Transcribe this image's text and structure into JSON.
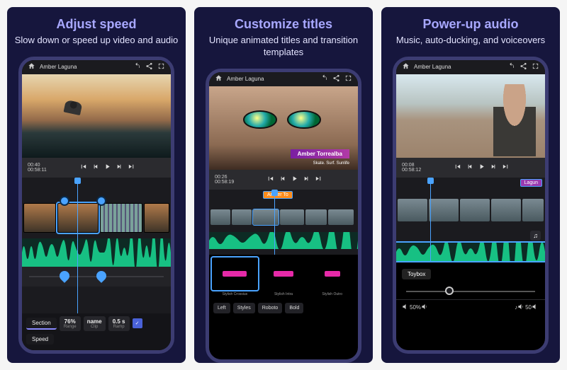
{
  "panels": [
    {
      "title": "Adjust speed",
      "subtitle": "Slow down or speed up\nvideo and audio"
    },
    {
      "title": "Customize titles",
      "subtitle": "Unique animated titles and\ntransition templates"
    },
    {
      "title": "Power-up audio",
      "subtitle": "Music, auto-ducking,\nand voiceovers"
    }
  ],
  "project_name": "Amber Laguna",
  "screens": {
    "speed": {
      "time_current": "00:40",
      "time_total": "00:58:11",
      "tabs": [
        "Section",
        "Speed"
      ],
      "tab_selected": "Section",
      "cells": [
        {
          "val": "76%",
          "lab": "Range"
        },
        {
          "val": "name",
          "lab": "Clip"
        },
        {
          "val": "0.5 s",
          "lab": "Ramp"
        }
      ]
    },
    "titles": {
      "time_current": "00:26",
      "time_total": "00:58:19",
      "badge_title": "Amber Torrealba",
      "badge_sub": "Skate. Surf. Sunlife",
      "chip": "Amber To",
      "templates": [
        "Stylish Crossius",
        "Stylish Intra",
        "Stylish Outro"
      ],
      "font_options": {
        "align": "Left",
        "style": "Styles",
        "font": "Roboto",
        "weight": "Bold"
      }
    },
    "audio": {
      "time_current": "00:08",
      "time_total": "00:58:12",
      "chip": "Lagun",
      "soundtrack": "Toybox",
      "left_pct": "50%",
      "right_val": "50"
    }
  }
}
